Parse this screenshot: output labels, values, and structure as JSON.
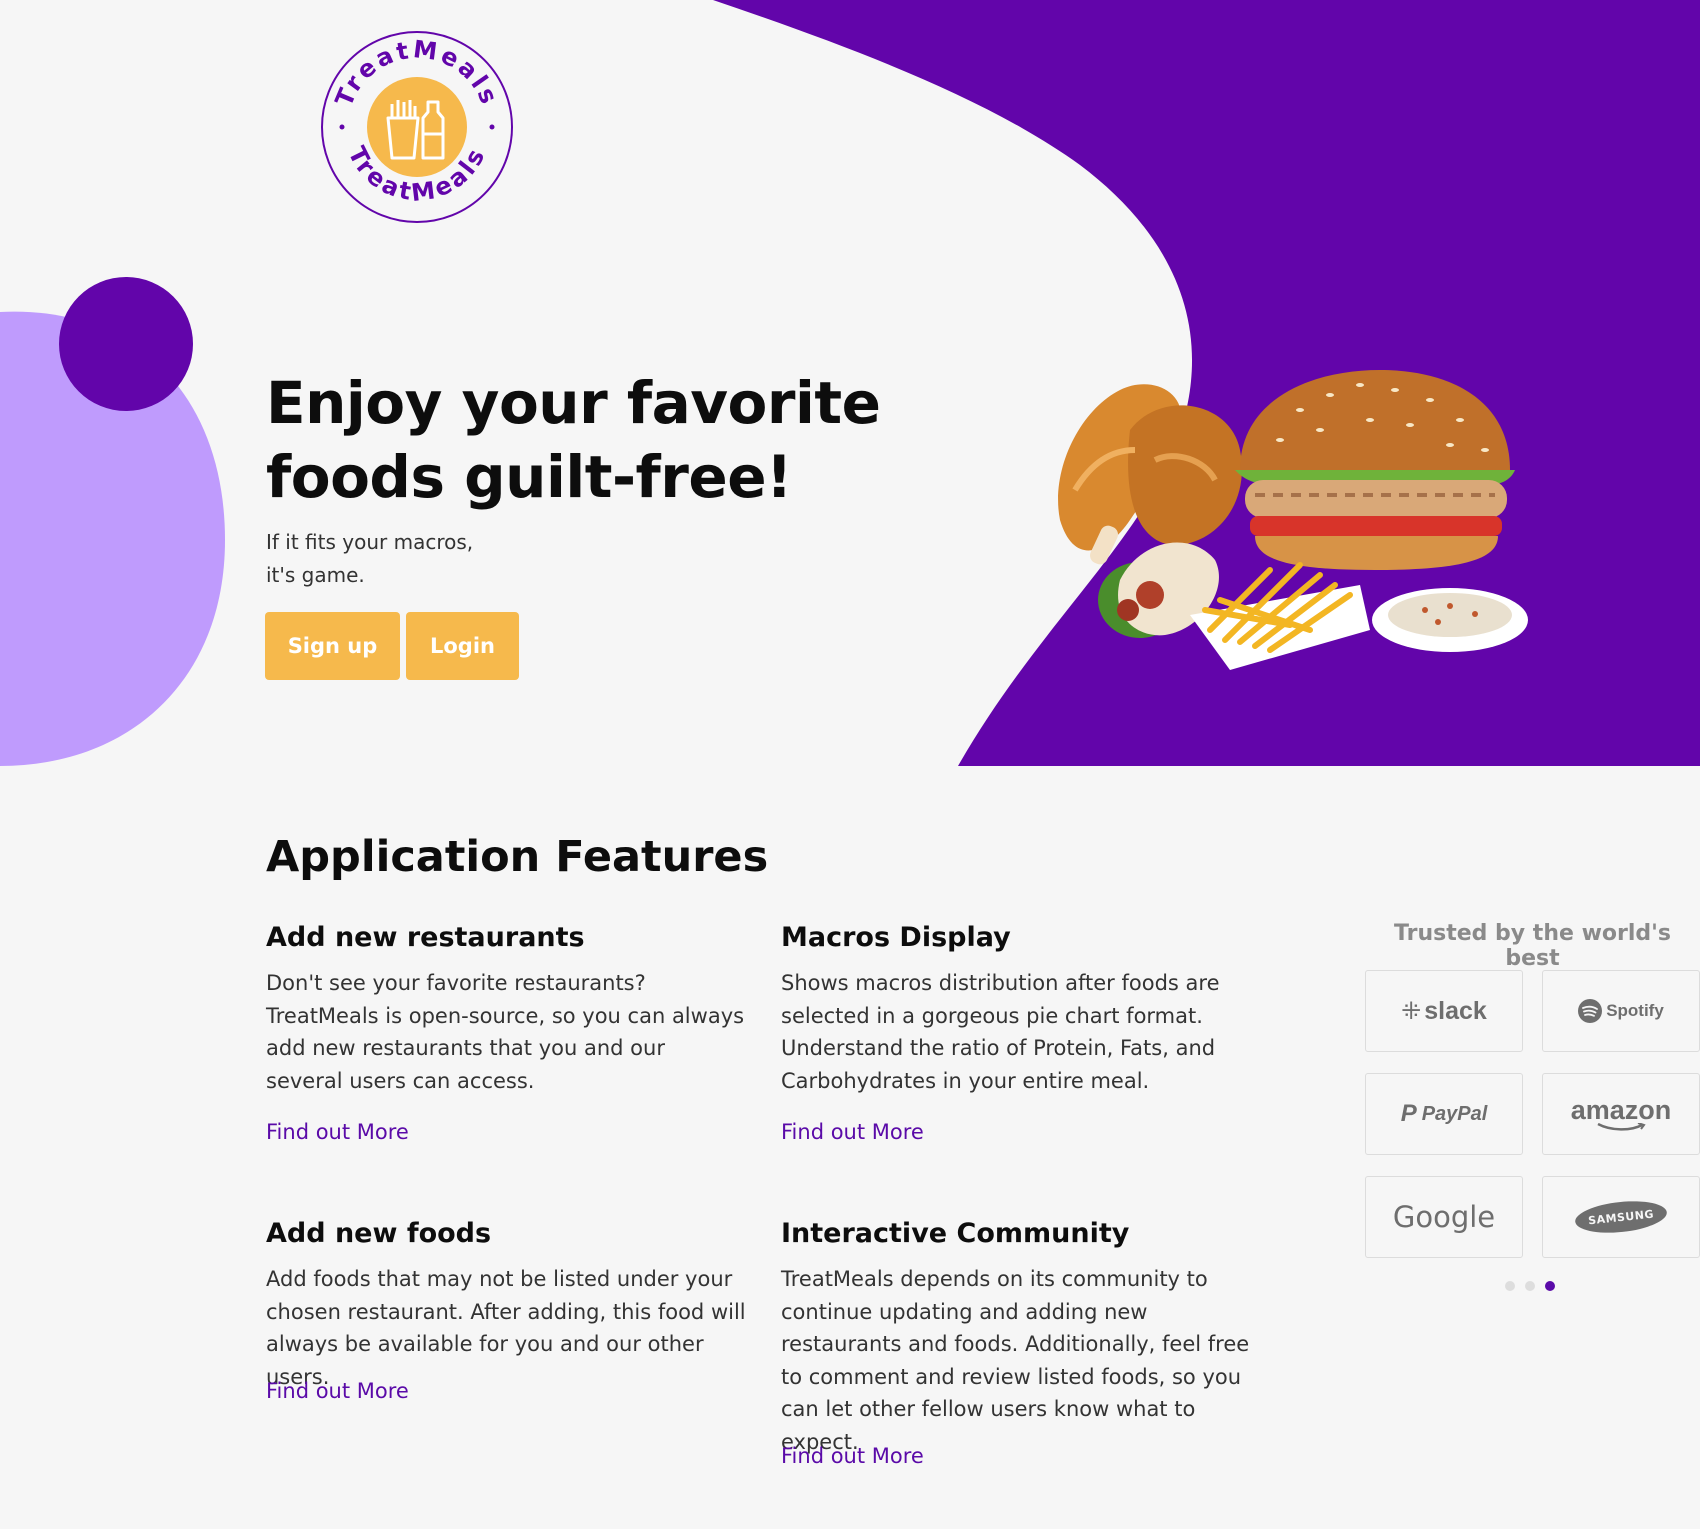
{
  "brand": {
    "name": "TreatMeals",
    "logo_top_text": "TreatMeals",
    "logo_bottom_text": "TreatMeals",
    "colors": {
      "purple": "#6205aa",
      "lavender": "#bf9bfd",
      "yellow": "#f6b94c",
      "link": "#5a0aa8"
    }
  },
  "hero": {
    "title": "Enjoy your favorite foods guilt-free!",
    "subtitle_line1": "If it fits your macros,",
    "subtitle_line2": "it's game.",
    "signup_label": "Sign up",
    "login_label": "Login"
  },
  "features": {
    "title": "Application Features",
    "items": [
      {
        "title": "Add new restaurants",
        "text": "Don't see your favorite restaurants? TreatMeals is open-source, so you can always add new restaurants that you and our several users can access.",
        "link": "Find out More"
      },
      {
        "title": "Macros Display",
        "text": "Shows macros distribution after foods are selected in a gorgeous pie chart format. Understand the ratio of Protein, Fats, and Carbohydrates in your entire meal.",
        "link": "Find out More"
      },
      {
        "title": "Add new foods",
        "text": "Add foods that may not be listed under your chosen restaurant. After adding, this food will always be available for you and our other users.",
        "link": "Find out More"
      },
      {
        "title": "Interactive Community",
        "text": "TreatMeals depends on its community to continue updating and adding new restaurants and foods. Additionally, feel free to comment and review listed foods, so you can let other fellow users know what to expect.",
        "link": "Find out More"
      }
    ]
  },
  "trusted": {
    "title": "Trusted by the world's best",
    "brands": [
      "slack",
      "Spotify",
      "PayPal",
      "amazon",
      "Google",
      "SAMSUNG"
    ],
    "carousel_active_index": 2
  }
}
